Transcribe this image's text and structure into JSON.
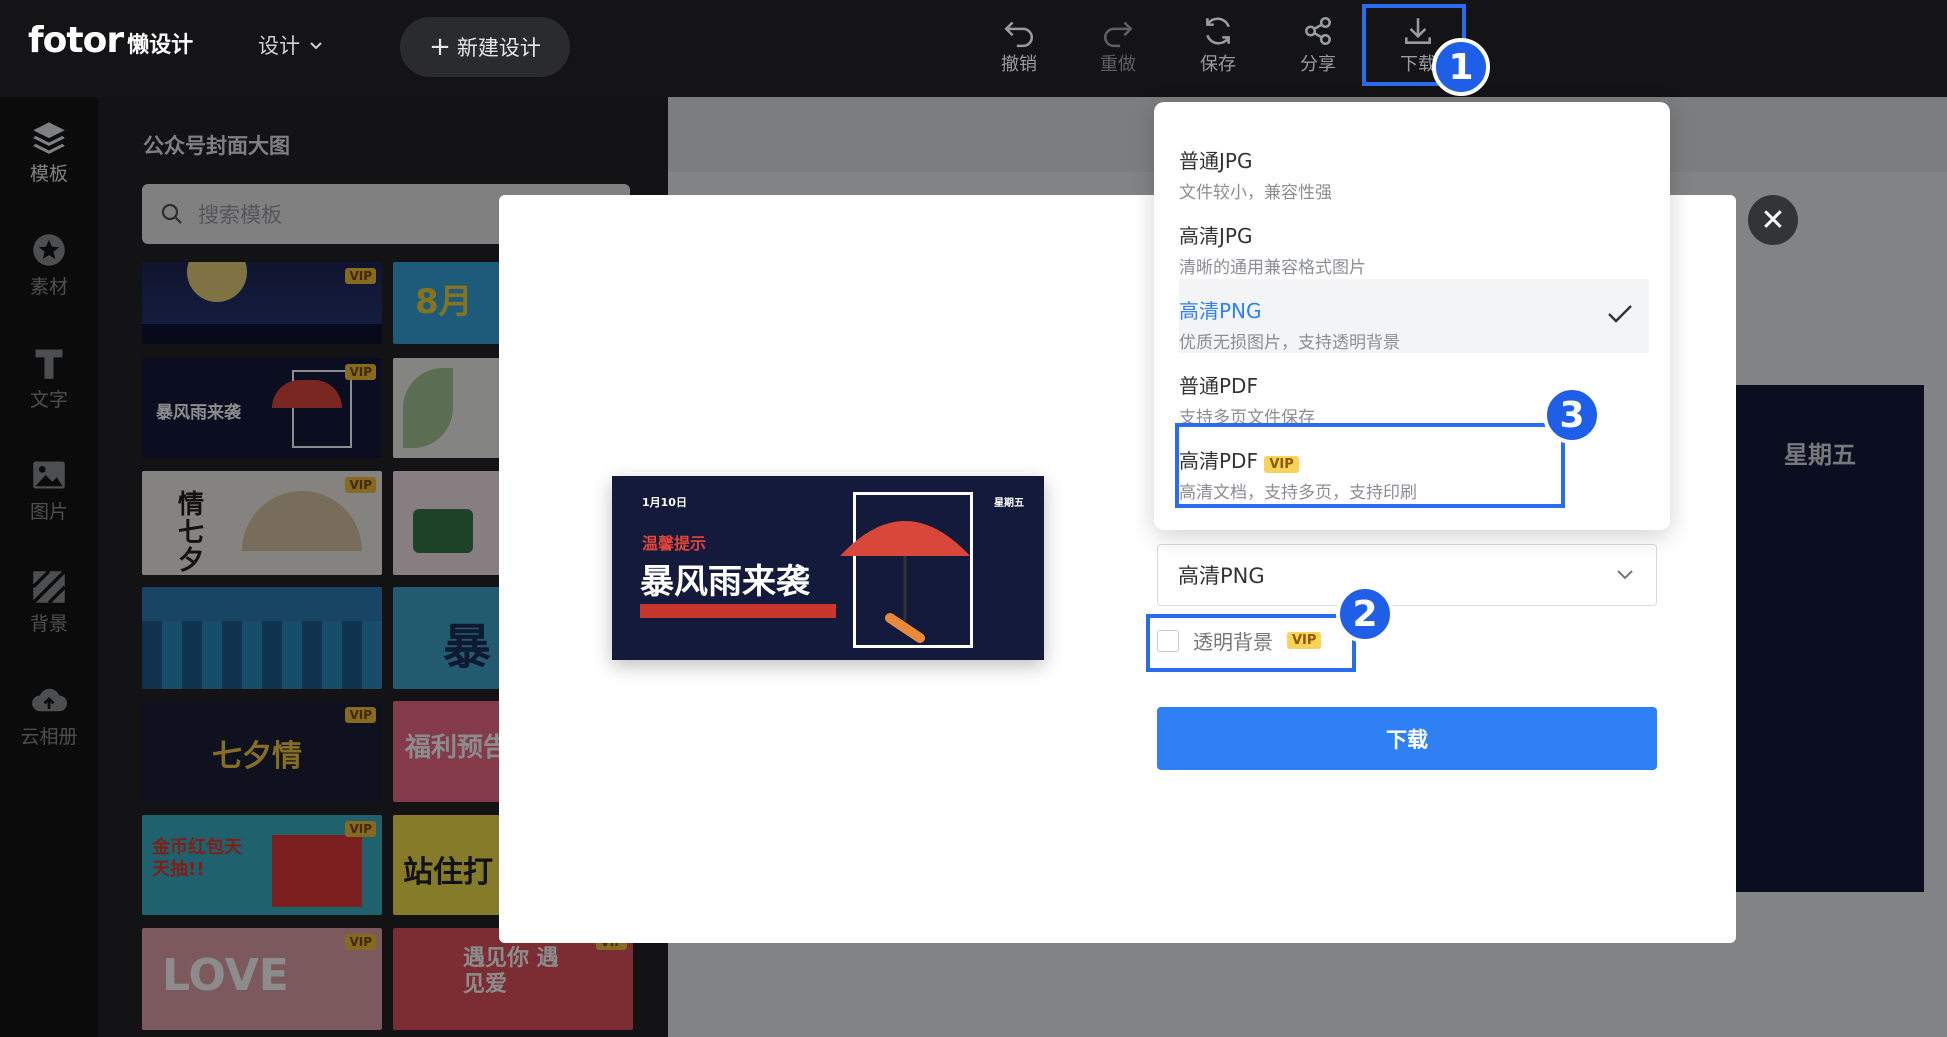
{
  "brand": {
    "name": "fotor",
    "sub": "懒设计"
  },
  "topbar": {
    "design_menu": "设计",
    "new_design": "新建设计",
    "tools": {
      "undo": "撤销",
      "redo": "重做",
      "save": "保存",
      "share": "分享",
      "download": "下载"
    }
  },
  "annotations": {
    "one": "1",
    "two": "2",
    "three": "3"
  },
  "leftnav": {
    "items": [
      {
        "label": "模板"
      },
      {
        "label": "素材"
      },
      {
        "label": "文字"
      },
      {
        "label": "图片"
      },
      {
        "label": "背景"
      },
      {
        "label": "云相册"
      }
    ]
  },
  "templates": {
    "title": "公众号封面大图",
    "search_placeholder": "搜索模板",
    "vip": "VIP",
    "texts": {
      "t2": "8月",
      "t3": "暴风雨来袭",
      "t5": "情 七夕",
      "t8": "暴",
      "t9": "七夕情",
      "t10": "福利预告",
      "t11": "金币红包天天抽!!",
      "t12": "站住打",
      "t13": "LOVE",
      "t14": "遇见你 遇见爱"
    }
  },
  "canvas": {
    "weekday": "星期五"
  },
  "modal": {
    "close_symbol": "✕",
    "preview": {
      "date": "1月10日",
      "weekday": "星期五",
      "tip": "温馨提示",
      "headline": "暴风雨来袭"
    },
    "format_select": {
      "value": "高清PNG"
    },
    "transparent_bg": {
      "label": "透明背景",
      "vip": "VIP"
    },
    "download_button": "下载"
  },
  "dropdown": {
    "options": [
      {
        "title": "普通JPG",
        "desc": "文件较小，兼容性强",
        "selected": false
      },
      {
        "title": "高清JPG",
        "desc": "清晰的通用兼容格式图片",
        "selected": false
      },
      {
        "title": "高清PNG",
        "desc": "优质无损图片，支持透明背景",
        "selected": true
      },
      {
        "title": "普通PDF",
        "desc": "支持多页文件保存",
        "selected": false
      },
      {
        "title": "高清PDF",
        "desc": "高清文档，支持多页，支持印刷",
        "vip": "VIP",
        "selected": false
      }
    ]
  },
  "colors": {
    "accent": "#2f80f4",
    "annotation": "#1f5fe8",
    "vip": "#f7d35a"
  }
}
